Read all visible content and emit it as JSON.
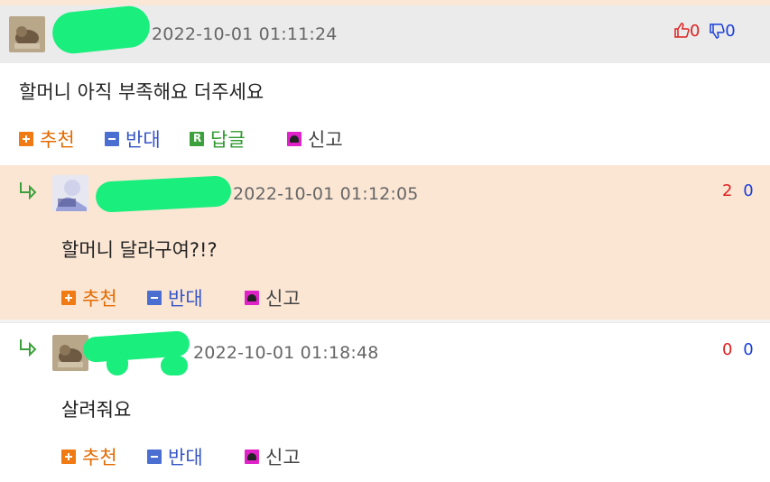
{
  "comments": [
    {
      "date": "2022-10-01 01:11:24",
      "text": "할머니 아직 부족해요 더주세요",
      "upvotes": "0",
      "downvotes": "0"
    },
    {
      "date": "2022-10-01 01:12:05",
      "text": "할머니 달라구여?!?",
      "upvotes": "2",
      "downvotes": "0"
    },
    {
      "date": "2022-10-01 01:18:48",
      "text": "살려줘요",
      "upvotes": "0",
      "downvotes": "0"
    }
  ],
  "actions": {
    "recommend": "추천",
    "oppose": "반대",
    "reply": "답글",
    "report": "신고"
  },
  "colors": {
    "highlight_bg": "#fbe6d4",
    "header_bg": "#ebebeb",
    "upvote": "#e02020",
    "downvote": "#1a3fd9",
    "redaction": "#1aee7d"
  },
  "icons": {
    "thumbs_up": "thumbs-up-icon",
    "thumbs_down": "thumbs-down-icon",
    "reply_arrow": "reply-arrow-icon"
  }
}
